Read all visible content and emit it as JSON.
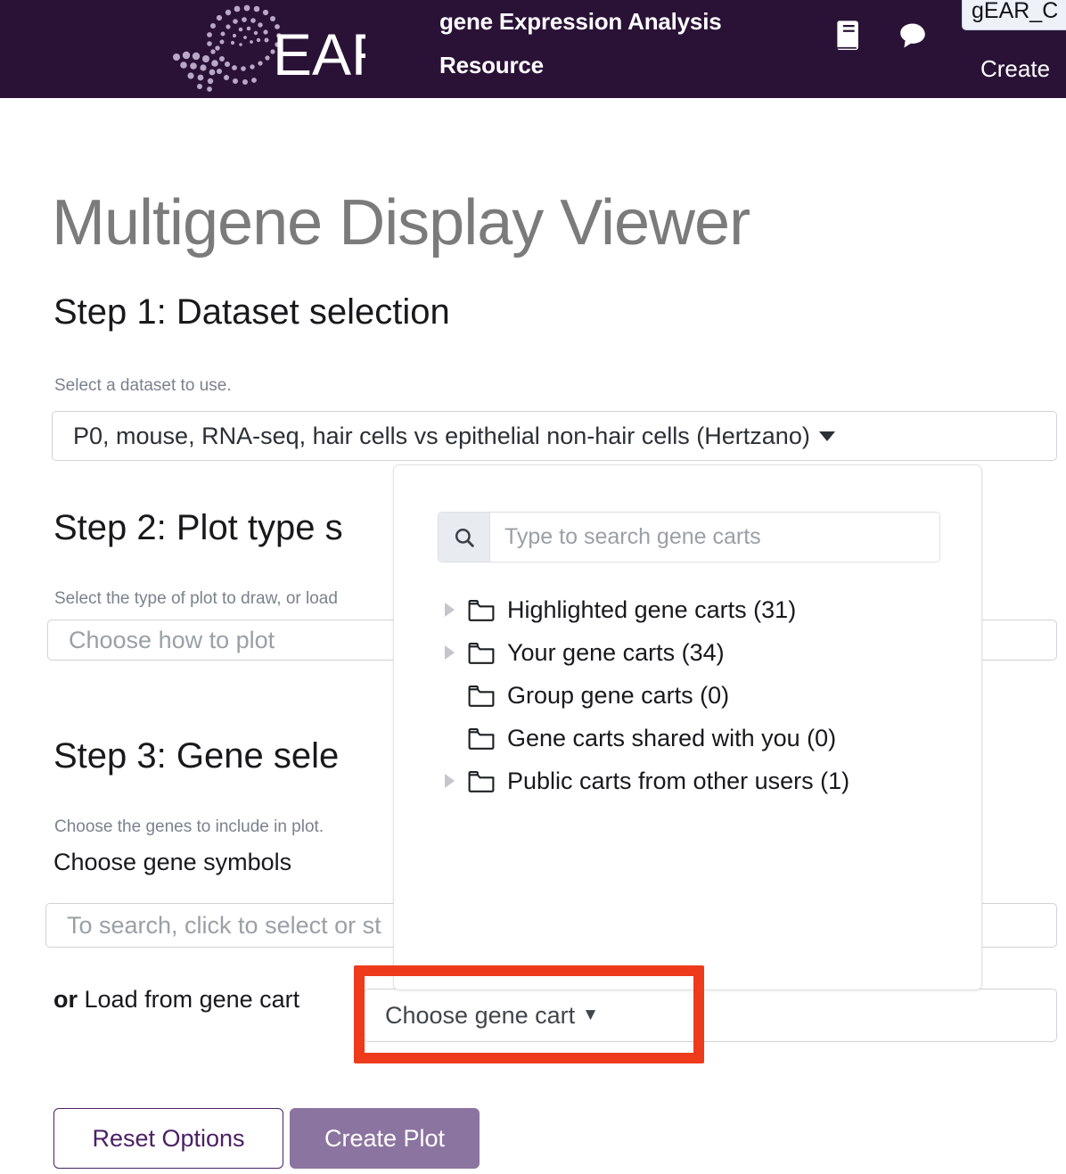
{
  "header": {
    "logo_text": "gEAR",
    "subtitle": "gene Expression Analysis Resource",
    "doc_icon": "book-icon",
    "comment_icon": "comment-bubble-icon",
    "search_value": "gEAR_C",
    "create_link": "Create",
    "background_color": "#2a1237"
  },
  "page": {
    "title": "Multigene Display Viewer"
  },
  "step1": {
    "heading": "Step 1: Dataset selection",
    "helper": "Select a dataset to use.",
    "dataset_value": "P0, mouse, RNA-seq, hair cells vs epithelial non-hair cells (Hertzano)"
  },
  "step2": {
    "heading": "Step 2: Plot type s",
    "helper": "Select the type of plot to draw, or load",
    "plot_type_placeholder": "Choose how to plot"
  },
  "step3": {
    "heading": "Step 3: Gene sele",
    "helper": "Choose the genes to include in plot.",
    "choose_gene_symbols_label": "Choose gene symbols",
    "gene_search_placeholder": "To search, click to select or st",
    "or_prefix": "or",
    "load_from_cart_label": "Load from gene cart",
    "gene_cart_value": "Choose gene cart"
  },
  "gene_cart_panel": {
    "search_placeholder": "Type to search gene carts",
    "search_icon": "search-icon",
    "items": [
      {
        "label": "Highlighted gene carts (31)",
        "expandable": true
      },
      {
        "label": "Your gene carts (34)",
        "expandable": true
      },
      {
        "label": "Group gene carts (0)",
        "expandable": false
      },
      {
        "label": "Gene carts shared with you (0)",
        "expandable": false
      },
      {
        "label": "Public carts from other users (1)",
        "expandable": true
      }
    ]
  },
  "highlight": {
    "color": "#ed3b1c"
  },
  "footer_actions": {
    "reset_label": "Reset Options",
    "create_label": "Create Plot",
    "reset_color": "#4b2065",
    "create_color": "#8c74a0"
  }
}
